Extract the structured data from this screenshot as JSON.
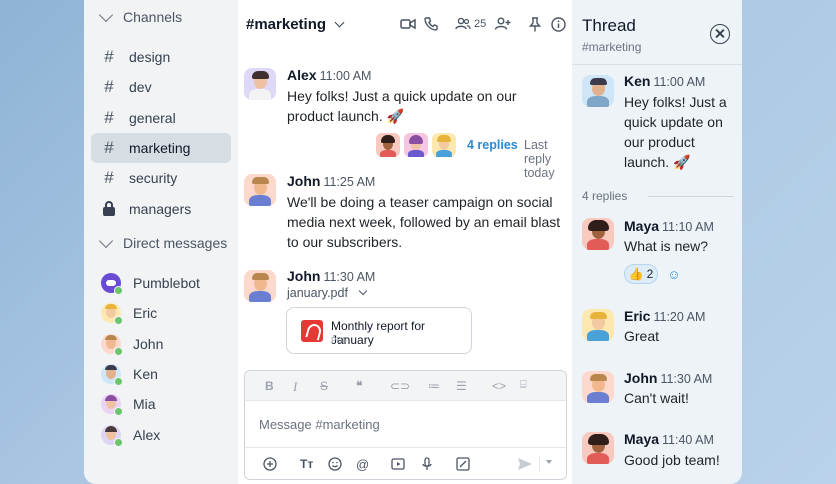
{
  "sidebar": {
    "channels_label": "Channels",
    "channels": [
      {
        "name": "design",
        "icon": "hash-icon"
      },
      {
        "name": "dev",
        "icon": "hash-icon"
      },
      {
        "name": "general",
        "icon": "hash-icon"
      },
      {
        "name": "marketing",
        "icon": "hash-icon",
        "active": true
      },
      {
        "name": "security",
        "icon": "hash-icon"
      },
      {
        "name": "managers",
        "icon": "lock-icon"
      }
    ],
    "dm_label": "Direct messages",
    "direct_messages": [
      {
        "name": "Pumblebot",
        "color": "#6a4bd6"
      },
      {
        "name": "Eric",
        "color": "#f5c34a"
      },
      {
        "name": "John",
        "color": "#f6a98c"
      },
      {
        "name": "Ken",
        "color": "#6fb2e8"
      },
      {
        "name": "Mia",
        "color": "#c98bd9"
      },
      {
        "name": "Alex",
        "color": "#b9a4e4"
      }
    ]
  },
  "header": {
    "hash": "#",
    "channel": "marketing",
    "member_count": "25"
  },
  "messages": [
    {
      "author": "Alex",
      "time": "11:00 AM",
      "text": "Hey folks! Just a quick update on our product launch. 🚀"
    },
    {
      "author": "John",
      "time": "11:25 AM",
      "text": "We'll be doing a teaser campaign on social media next week, followed by an email blast to our subscribers."
    },
    {
      "author": "John",
      "time": "11:30 AM",
      "attachment_label": "january.pdf"
    }
  ],
  "thread_info": {
    "replies_link": "4 replies",
    "last_reply": "Last reply today"
  },
  "file": {
    "name": "Monthly report for January",
    "type": "PDF"
  },
  "composer": {
    "placeholder": "Message #marketing"
  },
  "thread": {
    "title": "Thread",
    "subtitle": "#marketing",
    "root": {
      "author": "Ken",
      "time": "11:00 AM",
      "text": "Hey folks! Just a quick update on our product launch. 🚀"
    },
    "replies_count": "4 replies",
    "replies": [
      {
        "author": "Maya",
        "time": "11:10 AM",
        "text": "What is new?"
      },
      {
        "author": "Eric",
        "time": "11:20 AM",
        "text": "Great"
      },
      {
        "author": "John",
        "time": "11:30 AM",
        "text": "Can't wait!"
      },
      {
        "author": "Maya",
        "time": "11:40 AM",
        "text": "Good job team!"
      }
    ],
    "reaction": {
      "emoji": "👍",
      "count": "2"
    }
  },
  "colors": {
    "accent": "#2b8ad3",
    "active_channel_bg": "#d6dde3",
    "online": "#6cc56a",
    "pdf": "#e53935"
  }
}
